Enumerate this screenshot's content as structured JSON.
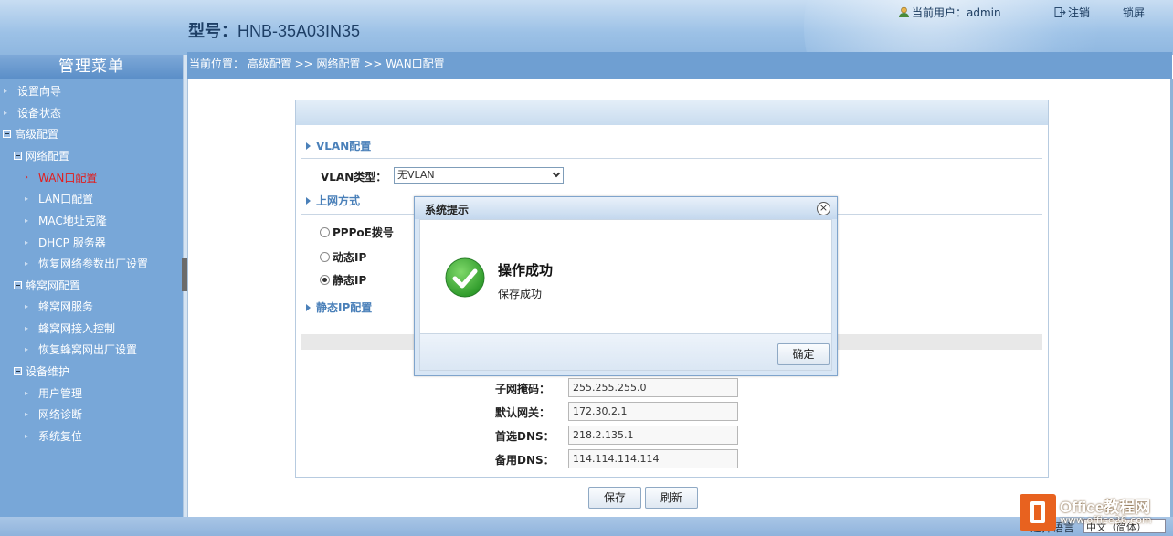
{
  "header": {
    "model_label": "型号",
    "model_sep": "：",
    "model_value": "HNB-35A03IN35",
    "current_user_label": "当前用户：",
    "current_user": "admin",
    "logout_label": "注销",
    "lock_label": "锁屏"
  },
  "sidebar": {
    "title": "管理菜单",
    "items": [
      {
        "label": "设置向导"
      },
      {
        "label": "设备状态"
      },
      {
        "label": "高级配置"
      },
      {
        "label": "网络配置"
      },
      {
        "label": "WAN口配置"
      },
      {
        "label": "LAN口配置"
      },
      {
        "label": "MAC地址克隆"
      },
      {
        "label": "DHCP 服务器"
      },
      {
        "label": "恢复网络参数出厂设置"
      },
      {
        "label": "蜂窝网配置"
      },
      {
        "label": "蜂窝网服务"
      },
      {
        "label": "蜂窝网接入控制"
      },
      {
        "label": "恢复蜂窝网出厂设置"
      },
      {
        "label": "设备维护"
      },
      {
        "label": "用户管理"
      },
      {
        "label": "网络诊断"
      },
      {
        "label": "系统复位"
      }
    ]
  },
  "breadcrumb": "当前位置： 高级配置 >> 网络配置 >> WAN口配置",
  "form": {
    "vlan_section": "VLAN配置",
    "vlan_type_label": "VLAN类型：",
    "vlan_type_value": "无VLAN",
    "internet_section": "上网方式",
    "modes": [
      {
        "label": "PPPoE拨号",
        "selected": false
      },
      {
        "label": "动态IP",
        "selected": false
      },
      {
        "label": "静态IP",
        "selected": true
      }
    ],
    "static_section": "静态IP配置",
    "fields": [
      {
        "label": "子网掩码：",
        "value": "255.255.255.0"
      },
      {
        "label": "默认网关：",
        "value": "172.30.2.1"
      },
      {
        "label": "首选DNS：",
        "value": "218.2.135.1"
      },
      {
        "label": "备用DNS：",
        "value": "114.114.114.114"
      }
    ],
    "save_label": "保存",
    "refresh_label": "刷新"
  },
  "dialog": {
    "title": "系统提示",
    "message": "操作成功",
    "detail": "保存成功",
    "ok_label": "确定",
    "close_symbol": "×"
  },
  "footer": {
    "language_label": "选择语言",
    "language_value": "中文（简体）"
  },
  "watermark": {
    "brand": "Office教程网",
    "url": "www.office26.com"
  },
  "colors": {
    "accent": "#6f9fd2",
    "sidebar": "#78a7d8",
    "active_item": "#e21d1d",
    "success": "#3aa53a"
  }
}
